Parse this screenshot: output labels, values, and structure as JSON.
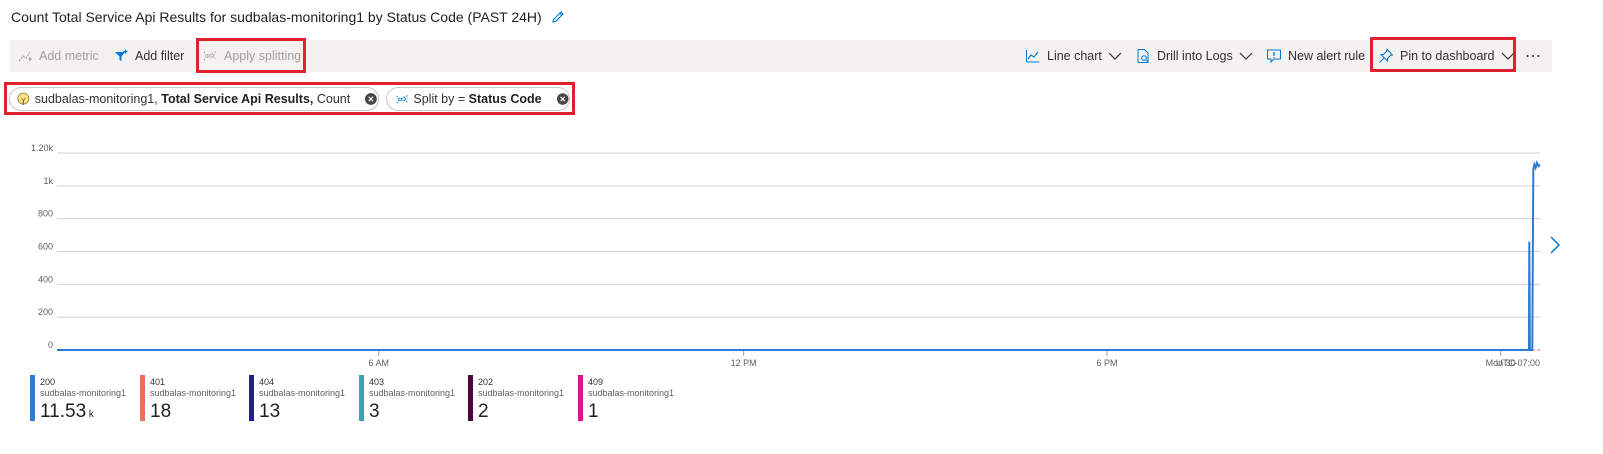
{
  "header": {
    "title": "Count Total Service Api Results for sudbalas-monitoring1 by Status Code (PAST 24H)"
  },
  "toolbar": {
    "add_metric": "Add metric",
    "add_filter": "Add filter",
    "apply_splitting": "Apply splitting",
    "line_chart": "Line chart",
    "drill_logs": "Drill into Logs",
    "new_alert": "New alert rule",
    "pin_dashboard": "Pin to dashboard",
    "more": "⋯"
  },
  "pills": {
    "metric": {
      "resource": "sudbalas-monitoring1,",
      "metric": "Total Service Api Results,",
      "aggregation": "Count"
    },
    "split": {
      "label": "Split by =",
      "value": "Status Code"
    }
  },
  "colors": {
    "accent": "#0078d4",
    "highlight": "#e3202e"
  },
  "chart_data": {
    "type": "line",
    "y_ticks": [
      "1.20k",
      "1k",
      "800",
      "600",
      "400",
      "200",
      "0"
    ],
    "ylim": [
      0,
      1200
    ],
    "x_ticks": [
      "6 AM",
      "12 PM",
      "6 PM",
      "Mon 30"
    ],
    "timezone": "UTC-07:00",
    "series": [
      {
        "name": "200",
        "color": "#2b7cd3",
        "points": [
          [
            0.0,
            0
          ],
          [
            0.9925,
            0
          ],
          [
            0.9928,
            660
          ],
          [
            0.9932,
            0
          ],
          [
            0.9948,
            0
          ],
          [
            0.9955,
            1100
          ],
          [
            0.9962,
            1130
          ],
          [
            0.997,
            1110
          ],
          [
            0.998,
            1140
          ],
          [
            0.999,
            1120
          ],
          [
            1.0,
            1130
          ]
        ]
      },
      {
        "name": "401",
        "color": "#e8735a",
        "points": [
          [
            0.0,
            0
          ],
          [
            1.0,
            0
          ]
        ]
      },
      {
        "name": "404",
        "color": "#1f1f8f",
        "points": [
          [
            0.0,
            0
          ],
          [
            1.0,
            0
          ]
        ]
      },
      {
        "name": "403",
        "color": "#3ba3b5",
        "points": [
          [
            0.0,
            0
          ],
          [
            1.0,
            0
          ]
        ]
      },
      {
        "name": "202",
        "color": "#4b0a3b",
        "points": [
          [
            0.0,
            0
          ],
          [
            1.0,
            0
          ]
        ]
      },
      {
        "name": "409",
        "color": "#d6168a",
        "points": [
          [
            0.0,
            0
          ],
          [
            1.0,
            0
          ]
        ]
      }
    ]
  },
  "legend": [
    {
      "code": "200",
      "resource": "sudbalas-monitoring1",
      "value": "11.53",
      "unit": "k",
      "color": "#2b7cd3"
    },
    {
      "code": "401",
      "resource": "sudbalas-monitoring1",
      "value": "18",
      "unit": "",
      "color": "#e8735a"
    },
    {
      "code": "404",
      "resource": "sudbalas-monitoring1",
      "value": "13",
      "unit": "",
      "color": "#1f1f8f"
    },
    {
      "code": "403",
      "resource": "sudbalas-monitoring1",
      "value": "3",
      "unit": "",
      "color": "#3ba3b5"
    },
    {
      "code": "202",
      "resource": "sudbalas-monitoring1",
      "value": "2",
      "unit": "",
      "color": "#4b0a3b"
    },
    {
      "code": "409",
      "resource": "sudbalas-monitoring1",
      "value": "1",
      "unit": "",
      "color": "#d6168a"
    }
  ]
}
